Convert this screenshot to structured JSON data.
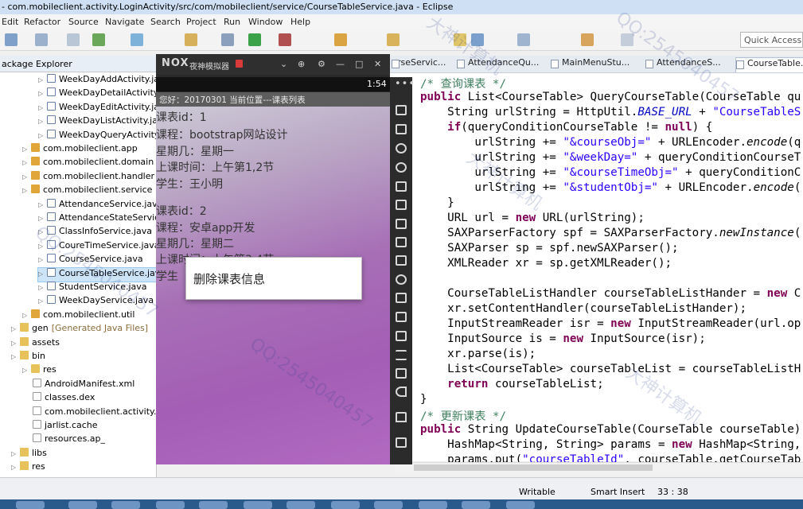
{
  "window": {
    "title": "- com.mobileclient.activity.LoginActivity/src/com/mobileclient/service/CourseTableService.java - Eclipse"
  },
  "menu": [
    "Edit",
    "Refactor",
    "Source",
    "Navigate",
    "Search",
    "Project",
    "Run",
    "Window",
    "Help"
  ],
  "toolbar": {
    "quick_access_placeholder": "Quick Access"
  },
  "package_explorer": {
    "title": "ackage Explorer",
    "rows": [
      {
        "label": "WeekDayAddActivity.java",
        "kind": "java"
      },
      {
        "label": "WeekDayDetailActivity.java",
        "kind": "java"
      },
      {
        "label": "WeekDayEditActivity.java",
        "kind": "java"
      },
      {
        "label": "WeekDayListActivity.java",
        "kind": "java"
      },
      {
        "label": "WeekDayQueryActivity.java",
        "kind": "java"
      },
      {
        "label": "com.mobileclient.app",
        "kind": "package"
      },
      {
        "label": "com.mobileclient.domain",
        "kind": "package"
      },
      {
        "label": "com.mobileclient.handler",
        "kind": "package"
      },
      {
        "label": "com.mobileclient.service",
        "kind": "package"
      },
      {
        "label": "AttendanceService.java",
        "kind": "java"
      },
      {
        "label": "AttendanceStateService.java",
        "kind": "java"
      },
      {
        "label": "ClassInfoService.java",
        "kind": "java"
      },
      {
        "label": "CoureTimeService.java",
        "kind": "java"
      },
      {
        "label": "CourseService.java",
        "kind": "java"
      },
      {
        "label": "CourseTableService.java",
        "kind": "java"
      },
      {
        "label": "StudentService.java",
        "kind": "java"
      },
      {
        "label": "WeekDayService.java",
        "kind": "java"
      },
      {
        "label": "com.mobileclient.util",
        "kind": "package"
      },
      {
        "label": "gen",
        "suffix": "[Generated Java Files]",
        "kind": "folder"
      },
      {
        "label": "assets",
        "kind": "folder"
      },
      {
        "label": "bin",
        "kind": "folder"
      },
      {
        "label": "res",
        "kind": "folder"
      },
      {
        "label": "AndroidManifest.xml",
        "kind": "file"
      },
      {
        "label": "classes.dex",
        "kind": "file"
      },
      {
        "label": "com.mobileclient.activity.Login",
        "kind": "file"
      },
      {
        "label": "jarlist.cache",
        "kind": "file"
      },
      {
        "label": "resources.ap_",
        "kind": "file"
      },
      {
        "label": "libs",
        "kind": "folder"
      },
      {
        "label": "res",
        "kind": "folder"
      }
    ]
  },
  "editor_tabs": [
    "urseServic...",
    "AttendanceQu...",
    "MainMenuStu...",
    "AttendanceS...",
    "CourseTable..."
  ],
  "code_lines": [
    "/* 查询课表 */",
    "public List<CourseTable> QueryCourseTable(CourseTable qu",
    "    String urlString = HttpUtil.BASE_URL + \"CourseTableS",
    "    if(queryConditionCourseTable != null) {",
    "        urlString += \"&courseObj=\" + URLEncoder.encode(q",
    "        urlString += \"&weekDay=\" + queryConditionCourseT",
    "        urlString += \"&courseTimeObj=\" + queryConditionC",
    "        urlString += \"&studentObj=\" + URLEncoder.encode(",
    "    }",
    "    URL url = new URL(urlString);",
    "    SAXParserFactory spf = SAXParserFactory.newInstance(",
    "    SAXParser sp = spf.newSAXParser();",
    "    XMLReader xr = sp.getXMLReader();",
    "",
    "    CourseTableListHandler courseTableListHander = new C",
    "    xr.setContentHandler(courseTableListHander);",
    "    InputStreamReader isr = new InputStreamReader(url.op",
    "    InputSource is = new InputSource(isr);",
    "    xr.parse(is);",
    "    List<CourseTable> courseTableList = courseTableListH",
    "    return courseTableList;",
    "}",
    "/* 更新课表 */",
    "public String UpdateCourseTable(CourseTable courseTable)",
    "    HashMap<String, String> params = new HashMap<String,",
    "    params.put(\"courseTableId\", courseTable.getCourseTab"
  ],
  "status": {
    "writable": "Writable",
    "insert_mode": "Smart Insert",
    "position": "33 : 38"
  },
  "emulator": {
    "logo": "NOX",
    "title": "夜神模拟器",
    "clock": "1:54",
    "app_header": "您好：20170301   当前位置---课表列表",
    "records": [
      {
        "id": "课表id：1",
        "course": "课程：bootstrap网站设计",
        "weekday": "星期几：星期一",
        "time": "上课时间：上午第1,2节",
        "student": "学生：王小明"
      },
      {
        "id": "课表id：2",
        "course": "课程：安卓app开发",
        "weekday": "星期几：星期二",
        "time": "上课时间：上午第3,4节",
        "student": "学生"
      }
    ],
    "context_menu_item": "删除课表信息"
  },
  "watermark": [
    "大神计算机",
    "QQ:2545040457"
  ]
}
